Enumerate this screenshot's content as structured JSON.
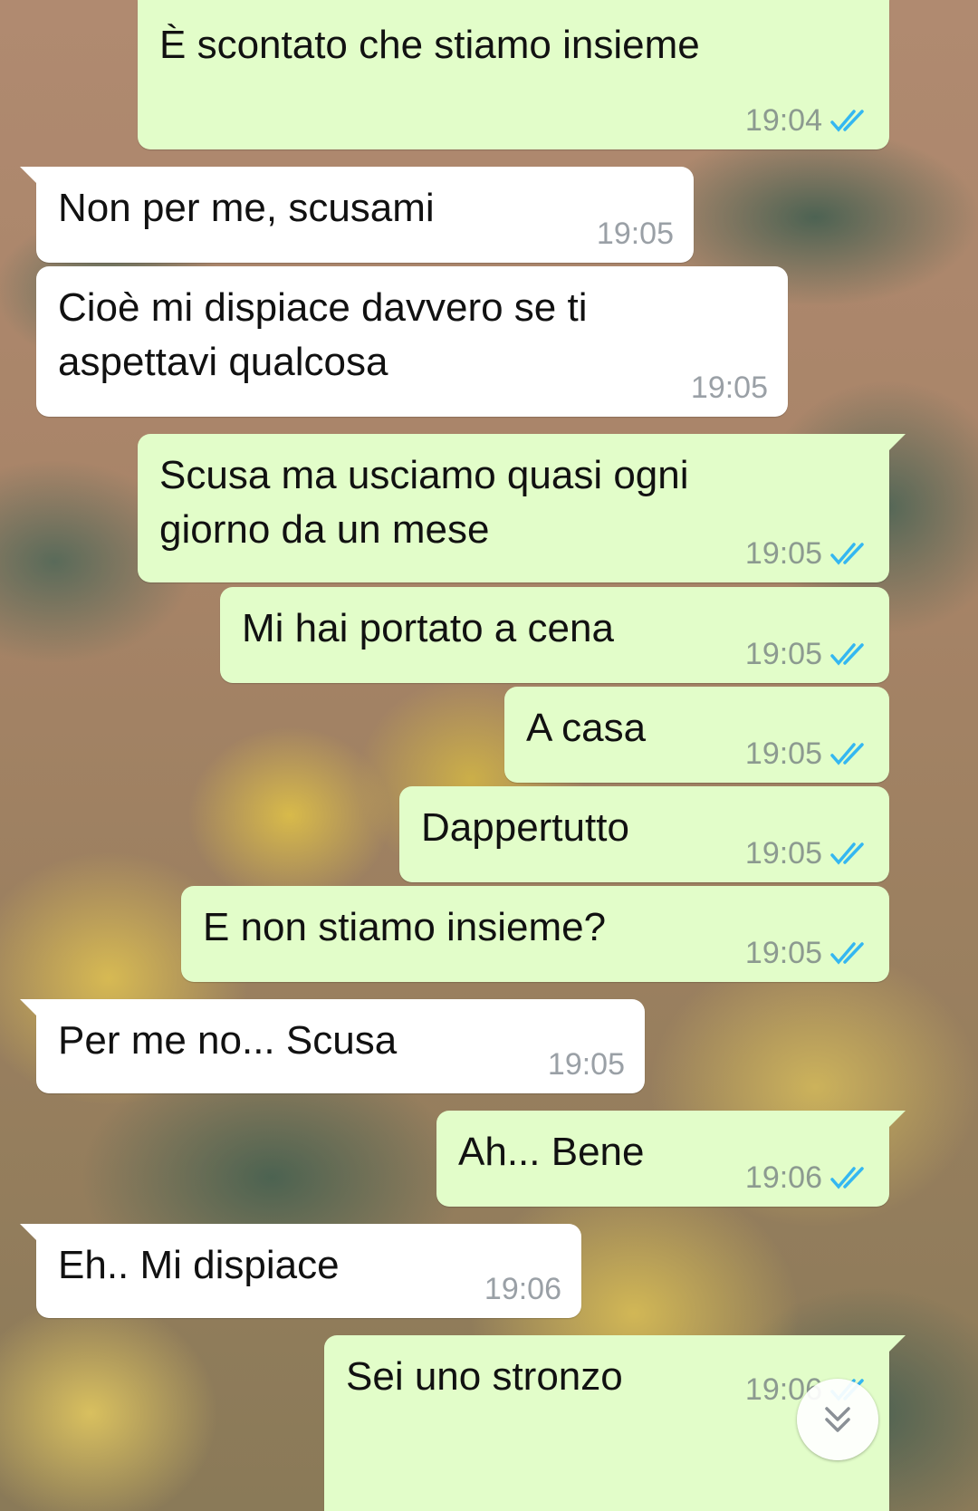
{
  "messages": [
    {
      "dir": "out",
      "text": "È scontato che stiamo insieme",
      "time": "19:04",
      "ticks": true
    },
    {
      "dir": "in",
      "text": "Non per me, scusami",
      "time": "19:05"
    },
    {
      "dir": "in",
      "text": "Cioè mi dispiace davvero se ti\naspettavi qualcosa",
      "time": "19:05"
    },
    {
      "dir": "out",
      "text": "Scusa ma usciamo quasi ogni\ngiorno da un mese",
      "time": "19:05",
      "ticks": true
    },
    {
      "dir": "out",
      "text": "Mi hai portato a cena",
      "time": "19:05",
      "ticks": true
    },
    {
      "dir": "out",
      "text": "A casa",
      "time": "19:05",
      "ticks": true
    },
    {
      "dir": "out",
      "text": "Dappertutto",
      "time": "19:05",
      "ticks": true
    },
    {
      "dir": "out",
      "text": "E non stiamo insieme?",
      "time": "19:05",
      "ticks": true
    },
    {
      "dir": "in",
      "text": "Per me no... Scusa",
      "time": "19:05"
    },
    {
      "dir": "out",
      "text": "Ah... Bene",
      "time": "19:06",
      "ticks": true
    },
    {
      "dir": "in",
      "text": "Eh.. Mi dispiace",
      "time": "19:06"
    },
    {
      "dir": "out",
      "text": "Sei uno stronzo",
      "time": "19:06",
      "ticks": true
    }
  ],
  "colors": {
    "outgoing_bubble": "#e2fdc9",
    "incoming_bubble": "#ffffff",
    "read_ticks": "#34b7f1"
  },
  "icons": {
    "read_receipt": "double-check-icon",
    "scroll_down": "chevron-double-down-icon"
  }
}
